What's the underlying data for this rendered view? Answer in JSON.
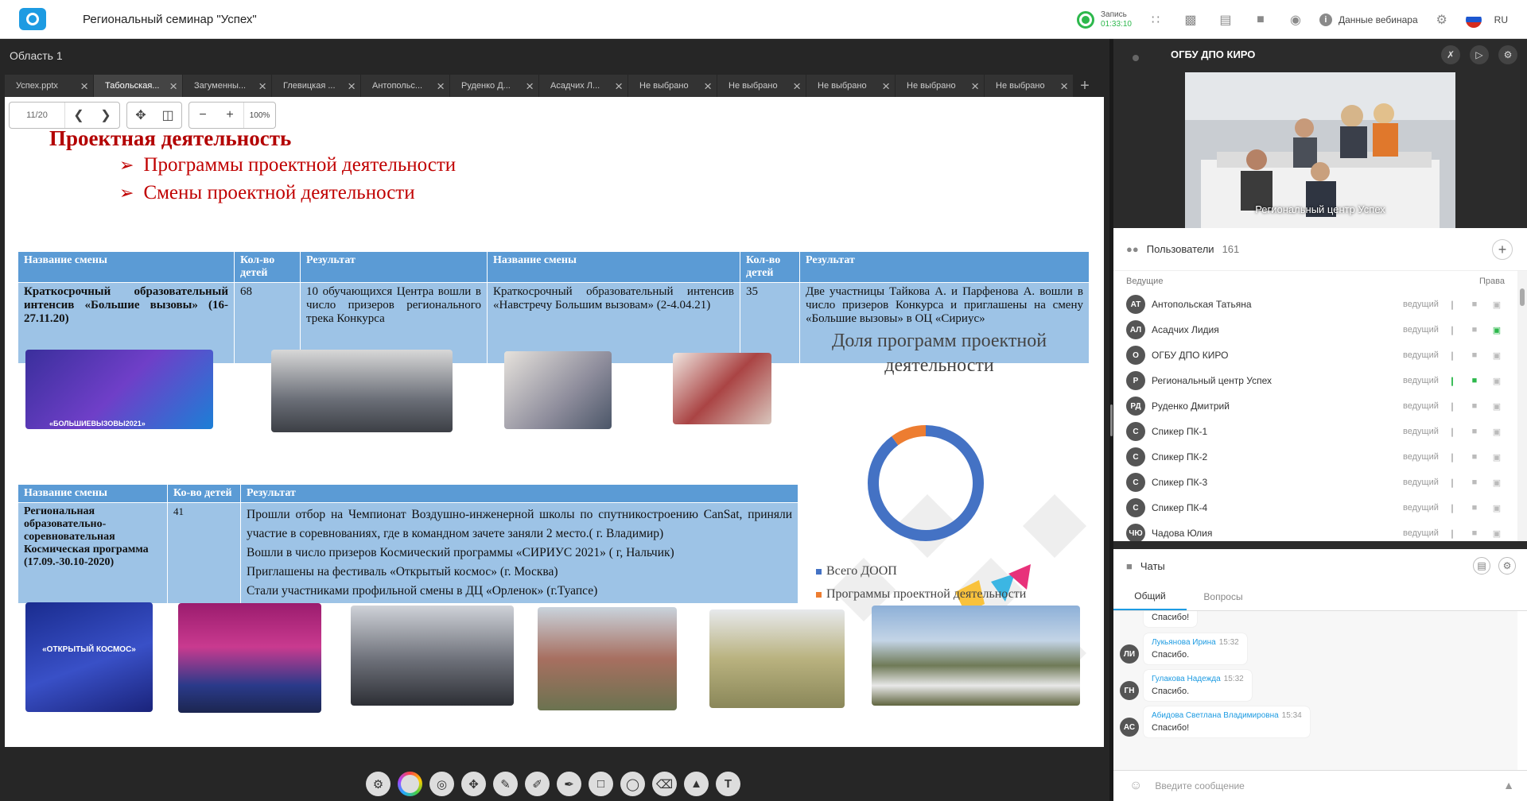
{
  "app": {
    "title": "Региональный семинар \"Успех\""
  },
  "top": {
    "rec_label": "Запись",
    "rec_time": "01:33:10",
    "webinar_data": "Данные вебинара",
    "lang": "RU"
  },
  "area": {
    "title": "Область 1"
  },
  "tabs": [
    "Успех.pptx",
    "Табольская...",
    "Загуменны...",
    "Глевицкая ...",
    "Антопольс...",
    "Руденко Д...",
    "Асадчих Л...",
    "Не выбрано",
    "Не выбрано",
    "Не выбрано",
    "Не выбрано",
    "Не выбрано"
  ],
  "slide_controls": {
    "page": "11/20",
    "zoom": "100%"
  },
  "slide": {
    "heading": "Проектная деятельность",
    "bullets": [
      "Программы проектной деятельности",
      "Смены проектной деятельности"
    ],
    "table1": {
      "headers": [
        "Название смены",
        "Кол-во детей",
        "Результат",
        "Название смены",
        "Кол-во детей",
        "Результат"
      ],
      "row": [
        "Краткосрочный образовательный интенсив «Большие вызовы» (16-27.11.20)",
        "68",
        "10 обучающихся Центра вошли в число призеров регионального трека Конкурса",
        "Краткосрочный образовательный интенсив «Навстречу Большим вызовам» (2-4.04.21)",
        "35",
        "Две участницы Тайкова А. и Парфенова А. вошли в число призеров Конкурса и приглашены на смену «Большие вызовы» в ОЦ «Сириус»"
      ]
    },
    "table2": {
      "headers": [
        "Название смены",
        "Ко-во детей",
        "Результат"
      ],
      "name": "Региональная образовательно-соревновательная Космическая программа (17.09.-30.10-2020)",
      "count": "41",
      "results": [
        "Прошли отбор на Чемпионат Воздушно-инженерной школы по спутникостроению CanSat, приняли участие в соревнованиях, где в командном зачете заняли 2 место.( г. Владимир)",
        "Вошли в число призеров  Космический программы «СИРИУС 2021» ( г, Нальчик)",
        "Приглашены на фестиваль «Открытый космос» (г. Москва)",
        "Стали участниками  профильной смены в ДЦ «Орленок» (г.Туапсе)"
      ]
    },
    "photo_texts": {
      "poster1": "«ОТКРЫТЫЙ КОСМОС»",
      "poster2": "«БОЛЬШИЕВЫЗОВЫ2021»"
    }
  },
  "chart_data": {
    "type": "pie",
    "title": "Доля программ проектной деятельности",
    "categories": [
      "Всего ДООП",
      "Программы проектной деятельности"
    ],
    "values": [
      90,
      10
    ],
    "colors": [
      "#4472c4",
      "#ed7d31"
    ],
    "legend": "bottom-left"
  },
  "video": {
    "name": "ОГБУ ДПО КИРО",
    "label": "Региональный центр Успех"
  },
  "users": {
    "title": "Пользователи",
    "count": "161",
    "section": "Ведущие",
    "rights": "Права",
    "list": [
      {
        "initials": "АТ",
        "name": "Антопольская Татьяна",
        "role": "ведущий",
        "mic": false,
        "cam": false,
        "screen": false
      },
      {
        "initials": "АЛ",
        "name": "Асадчих Лидия",
        "role": "ведущий",
        "mic": false,
        "cam": false,
        "screen": true
      },
      {
        "initials": "О",
        "name": "ОГБУ ДПО КИРО",
        "role": "ведущий",
        "mic": false,
        "cam": false,
        "screen": false
      },
      {
        "initials": "Р",
        "name": "Региональный центр Успех",
        "role": "ведущий",
        "mic": true,
        "cam": true,
        "screen": false
      },
      {
        "initials": "РД",
        "name": "Руденко Дмитрий",
        "role": "ведущий",
        "mic": false,
        "cam": false,
        "screen": false
      },
      {
        "initials": "С",
        "name": "Спикер ПК-1",
        "role": "ведущий",
        "mic": false,
        "cam": false,
        "screen": false
      },
      {
        "initials": "С",
        "name": "Спикер ПК-2",
        "role": "ведущий",
        "mic": false,
        "cam": false,
        "screen": false
      },
      {
        "initials": "С",
        "name": "Спикер ПК-3",
        "role": "ведущий",
        "mic": false,
        "cam": false,
        "screen": false
      },
      {
        "initials": "С",
        "name": "Спикер ПК-4",
        "role": "ведущий",
        "mic": false,
        "cam": false,
        "screen": false
      },
      {
        "initials": "ЧЮ",
        "name": "Чадова Юлия",
        "role": "ведущий",
        "mic": false,
        "cam": false,
        "screen": false
      }
    ]
  },
  "chat": {
    "title": "Чаты",
    "tabs": [
      "Общий",
      "Вопросы"
    ],
    "messages": [
      {
        "initials": "",
        "author": "",
        "time": "",
        "text": "Спасибо!"
      },
      {
        "initials": "ЛИ",
        "author": "Лукьянова Ирина",
        "time": "15:32",
        "text": "Спасибо."
      },
      {
        "initials": "ГН",
        "author": "Гулакова Надежда",
        "time": "15:32",
        "text": "Спасибо."
      },
      {
        "initials": "АС",
        "author": "Абидова Светлана Владимировна",
        "time": "15:34",
        "text": "Спасибо!"
      }
    ],
    "placeholder": "Введите сообщение"
  }
}
